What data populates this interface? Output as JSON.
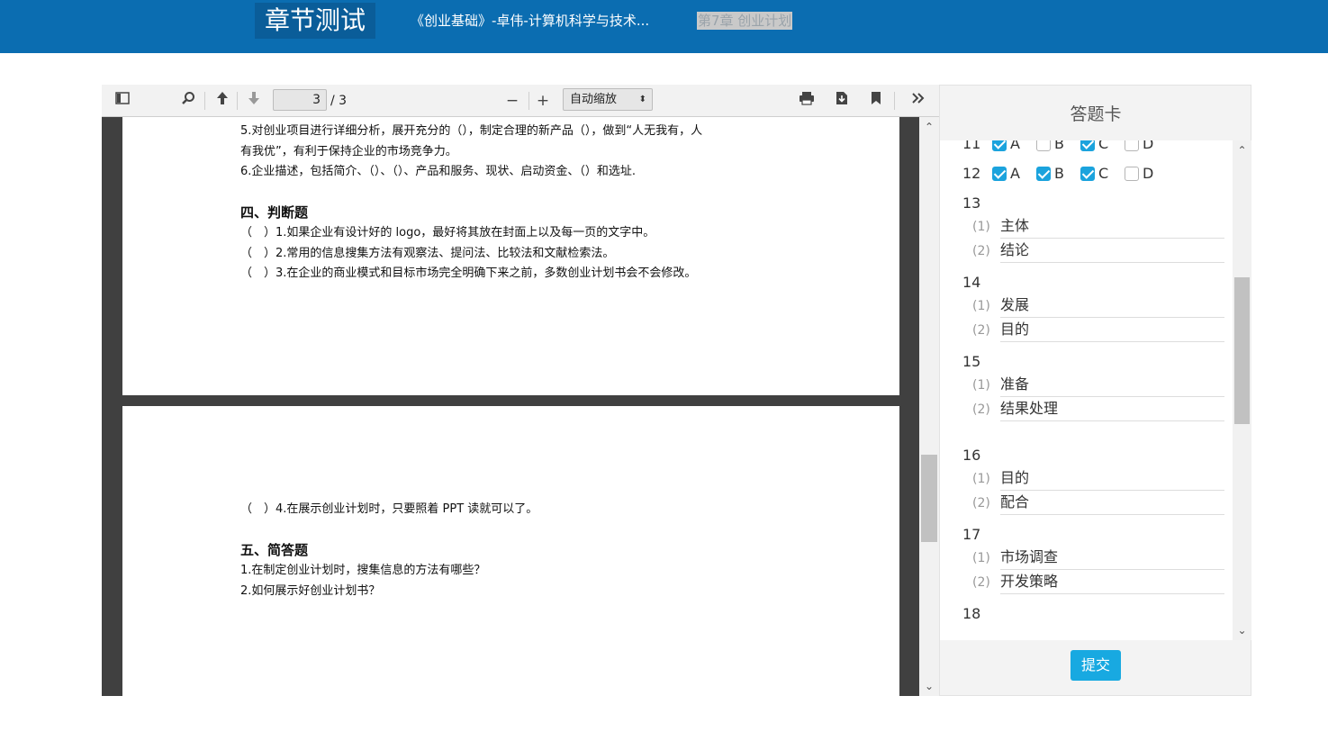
{
  "header": {
    "brand": "章节测试",
    "course_title": "《创业基础》-卓伟-计算机科学与技术...",
    "chapter": "第7章 创业计划"
  },
  "pdf_toolbar": {
    "sidebar_toggle_icon": "sidebar-toggle-icon",
    "search_icon": "search-icon",
    "prev_page_icon": "arrow-up-icon",
    "next_page_icon": "arrow-down-icon",
    "page_number": "3",
    "page_count": "/ 3",
    "zoom_out": "−",
    "zoom_in": "+",
    "zoom_value": "自动缩放",
    "print_icon": "printer-icon",
    "download_icon": "download-icon",
    "bookmark_icon": "bookmark-icon",
    "tools_icon": "double-chevron-icon"
  },
  "pdf_content": {
    "page1": {
      "line1": "5.对创业项目进行详细分析，展开充分的（），制定合理的新产品（），做到“人无我有，人",
      "line2": "有我优”，有利于保持企业的市场竞争力。",
      "line3": "6.企业描述，包括简介、（）、（）、产品和服务、现状、启动资金、（）和选址.",
      "heading": "四、判断题",
      "tf1": "（　）1.如果企业有设计好的 logo，最好将其放在封面上以及每一页的文字中。",
      "tf2": "（　）2.常用的信息搜集方法有观察法、提问法、比较法和文献检索法。",
      "tf3": "（　）3.在企业的商业模式和目标市场完全明确下来之前，多数创业计划书会不会修改。"
    },
    "page2": {
      "tf4": "（　）4.在展示创业计划时，只要照着 PPT 读就可以了。",
      "heading": "五、简答题",
      "q1": "1.在制定创业计划时，搜集信息的方法有哪些？",
      "q2": "2.如何展示好创业计划书？"
    }
  },
  "answer_card": {
    "title": "答题卡",
    "questions": [
      {
        "num": "11",
        "options": [
          {
            "label": "A",
            "checked": true
          },
          {
            "label": "B",
            "checked": false
          },
          {
            "label": "C",
            "checked": true
          },
          {
            "label": "D",
            "checked": false
          }
        ]
      },
      {
        "num": "12",
        "options": [
          {
            "label": "A",
            "checked": true
          },
          {
            "label": "B",
            "checked": true
          },
          {
            "label": "C",
            "checked": true
          },
          {
            "label": "D",
            "checked": false
          }
        ]
      },
      {
        "num": "13",
        "blanks": [
          {
            "idx": "(1)",
            "value": "主体"
          },
          {
            "idx": "(2)",
            "value": "结论"
          }
        ]
      },
      {
        "num": "14",
        "blanks": [
          {
            "idx": "(1)",
            "value": "发展"
          },
          {
            "idx": "(2)",
            "value": "目的"
          }
        ]
      },
      {
        "num": "15",
        "blanks": [
          {
            "idx": "(1)",
            "value": "准备"
          },
          {
            "idx": "(2)",
            "value": "结果处理"
          }
        ]
      },
      {
        "num": "16",
        "blanks": [
          {
            "idx": "(1)",
            "value": "目的"
          },
          {
            "idx": "(2)",
            "value": "配合"
          }
        ]
      },
      {
        "num": "17",
        "blanks": [
          {
            "idx": "(1)",
            "value": "市场调查"
          },
          {
            "idx": "(2)",
            "value": "开发策略"
          }
        ]
      },
      {
        "num": "18"
      }
    ],
    "submit_label": "提交"
  }
}
